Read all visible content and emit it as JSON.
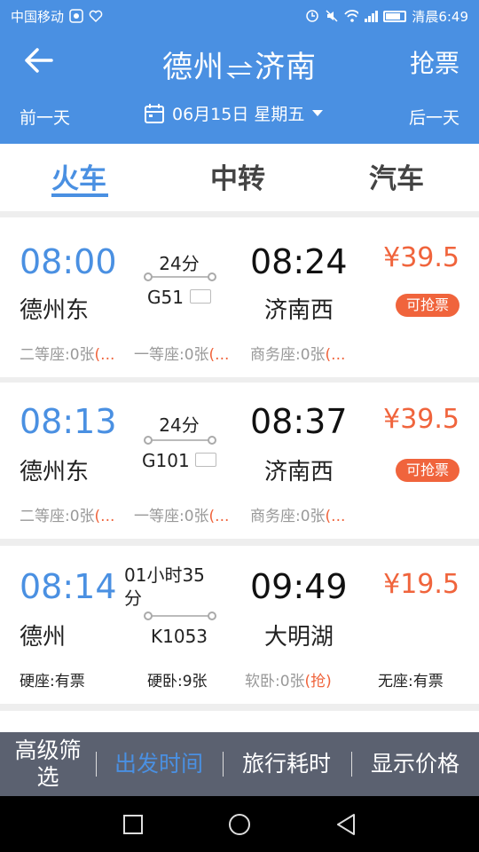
{
  "status_bar": {
    "carrier": "中国移动",
    "time": "清晨6:49"
  },
  "header": {
    "title_from": "德州",
    "title_to": "济南",
    "grab_label": "抢票",
    "prev_day": "前一天",
    "next_day": "后一天",
    "date": "06月15日 星期五"
  },
  "tabs": [
    {
      "label": "火车",
      "active": true
    },
    {
      "label": "中转",
      "active": false
    },
    {
      "label": "汽车",
      "active": false
    }
  ],
  "trains": [
    {
      "dep_time": "08:00",
      "dep_station": "德州东",
      "duration": "24分",
      "train_no": "G51",
      "arr_time": "08:24",
      "arr_station": "济南西",
      "price": "¥39.5",
      "badge": "可抢票",
      "seats": [
        {
          "name": "二等座:0张",
          "grab": "(..."
        },
        {
          "name": "一等座:0张",
          "grab": "(..."
        },
        {
          "name": "商务座:0张",
          "grab": "(..."
        }
      ]
    },
    {
      "dep_time": "08:13",
      "dep_station": "德州东",
      "duration": "24分",
      "train_no": "G101",
      "arr_time": "08:37",
      "arr_station": "济南西",
      "price": "¥39.5",
      "badge": "可抢票",
      "seats": [
        {
          "name": "二等座:0张",
          "grab": "(..."
        },
        {
          "name": "一等座:0张",
          "grab": "(..."
        },
        {
          "name": "商务座:0张",
          "grab": "(..."
        }
      ]
    },
    {
      "dep_time": "08:14",
      "dep_station": "德州",
      "duration": "01小时35分",
      "train_no": "K1053",
      "arr_time": "09:49",
      "arr_station": "大明湖",
      "price": "¥19.5",
      "seats": [
        {
          "name": "硬座:有票"
        },
        {
          "name": "硬卧:9张"
        },
        {
          "name": "软卧:0张",
          "grab": "(抢)"
        },
        {
          "name": "无座:有票"
        }
      ]
    }
  ],
  "filter_bar": {
    "advanced": "高级筛选",
    "departure_time": "出发时间",
    "travel_time": "旅行耗时",
    "show_price": "显示价格"
  },
  "colors": {
    "primary": "#4a90e2",
    "accent": "#f0643c",
    "filter_bg": "#5b6170"
  }
}
